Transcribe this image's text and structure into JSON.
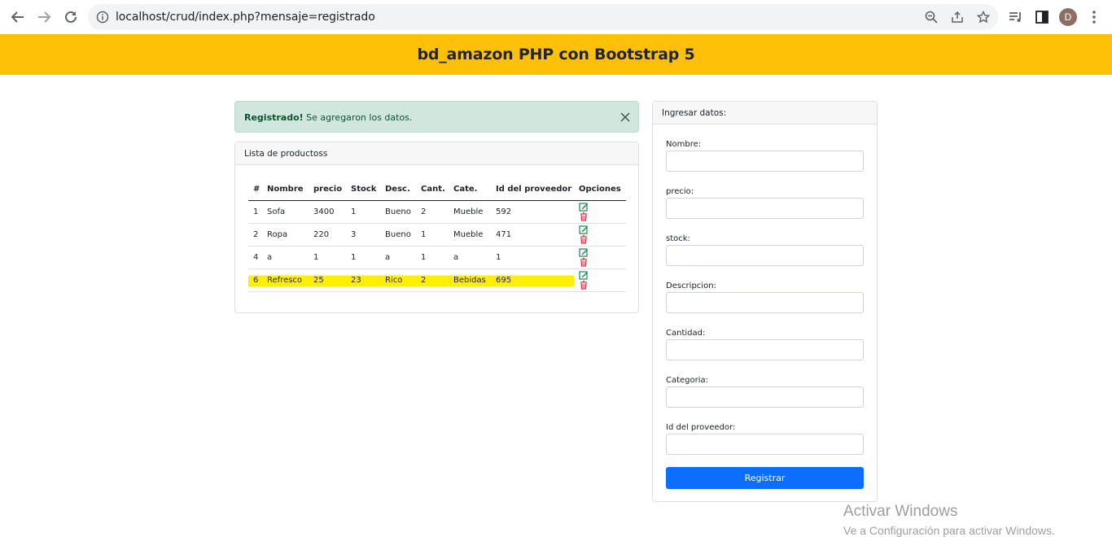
{
  "browser": {
    "url": "localhost/crud/index.php?mensaje=registrado",
    "avatar_letter": "D"
  },
  "header": {
    "title": "bd_amazon PHP con Bootstrap 5"
  },
  "alert": {
    "strong": "Registrado!",
    "text": " Se agregaron los datos."
  },
  "list": {
    "title": "Lista de productoss",
    "columns": [
      "#",
      "Nombre",
      "precio",
      "Stock",
      "Desc.",
      "Cant.",
      "Cate.",
      "Id del proveedor",
      "Opciones"
    ],
    "rows": [
      [
        "1",
        "Sofa",
        "3400",
        "1",
        "Bueno",
        "2",
        "Mueble",
        "592"
      ],
      [
        "2",
        "Ropa",
        "220",
        "3",
        "Bueno",
        "1",
        "Mueble",
        "471"
      ],
      [
        "4",
        "a",
        "1",
        "1",
        "a",
        "1",
        "a",
        "1"
      ],
      [
        "6",
        "Refresco",
        "25",
        "23",
        "Rico",
        "2",
        "Bebidas",
        "695"
      ]
    ],
    "highlight_color": "#ffef00"
  },
  "form": {
    "title": "Ingresar datos:",
    "labels": [
      "Nombre:",
      "precio:",
      "stock:",
      "Descripcion:",
      "Cantidad:",
      "Categoria:",
      "Id del proveedor:"
    ],
    "submit": "Registrar"
  },
  "colors": {
    "header": "#ffc107",
    "alert_bg": "#d1e7dd",
    "button": "#0d6efd"
  },
  "watermark": {
    "line1": "Activar Windows",
    "line2": "Ve a Configuración para activar Windows."
  }
}
